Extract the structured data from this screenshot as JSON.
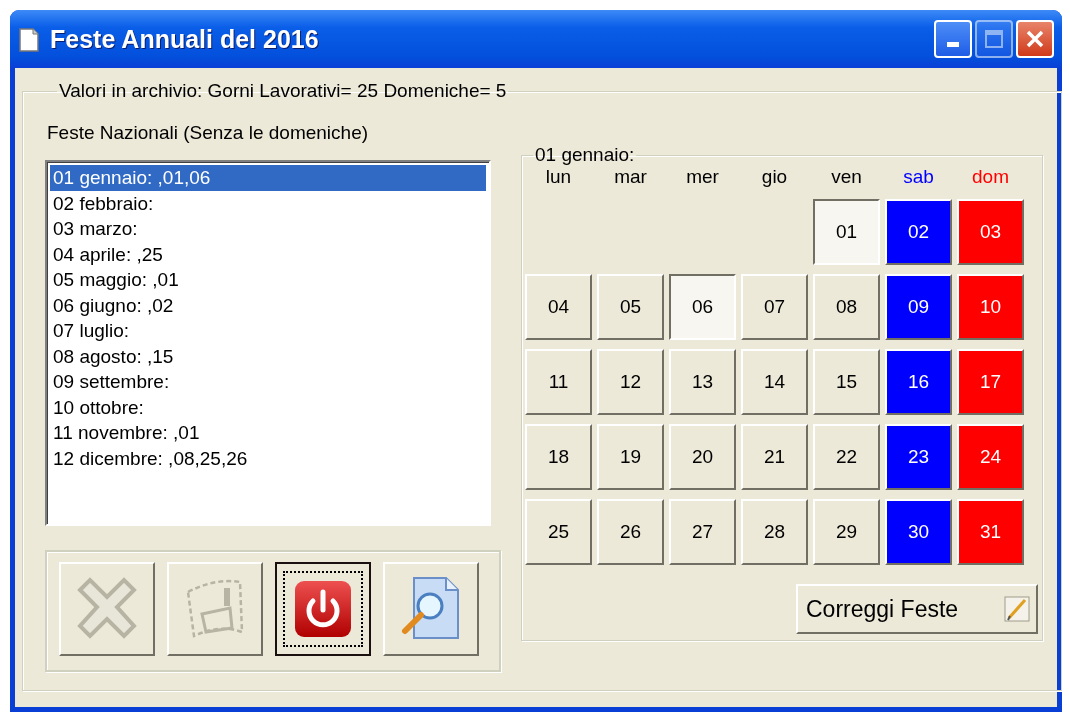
{
  "window": {
    "title": "Feste Annuali del 2016"
  },
  "title_buttons": [
    {
      "kind": "minimize",
      "disabled": false
    },
    {
      "kind": "maximize",
      "disabled": true
    },
    {
      "kind": "close",
      "disabled": false
    }
  ],
  "archive_group": {
    "legend": "Valori in archivio: Gorni Lavorativi= 25 Domeniche= 5"
  },
  "holidays_label": "Feste Nazionali (Senza le domeniche)",
  "holidays_list": [
    {
      "text": "01 gennaio: ,01,06",
      "selected": true
    },
    {
      "text": "02 febbraio:",
      "selected": false
    },
    {
      "text": "03 marzo:",
      "selected": false
    },
    {
      "text": "04 aprile: ,25",
      "selected": false
    },
    {
      "text": "05 maggio: ,01",
      "selected": false
    },
    {
      "text": "06 giugno: ,02",
      "selected": false
    },
    {
      "text": "07 luglio:",
      "selected": false
    },
    {
      "text": "08 agosto: ,15",
      "selected": false
    },
    {
      "text": "09 settembre:",
      "selected": false
    },
    {
      "text": "10 ottobre:",
      "selected": false
    },
    {
      "text": "11 novembre: ,01",
      "selected": false
    },
    {
      "text": "12 dicembre: ,08,25,26",
      "selected": false
    }
  ],
  "toolbar_buttons": [
    {
      "kind": "delete",
      "disabled": true,
      "focused": false
    },
    {
      "kind": "save",
      "disabled": true,
      "focused": false
    },
    {
      "kind": "power",
      "disabled": false,
      "focused": true
    },
    {
      "kind": "preview",
      "disabled": false,
      "focused": false
    }
  ],
  "calendar": {
    "legend": "01 gennaio:",
    "weekdays": [
      {
        "text": "lun",
        "kind": "weekday"
      },
      {
        "text": "mar",
        "kind": "weekday"
      },
      {
        "text": "mer",
        "kind": "weekday"
      },
      {
        "text": "gio",
        "kind": "weekday"
      },
      {
        "text": "ven",
        "kind": "weekday"
      },
      {
        "text": "sab",
        "kind": "saturday"
      },
      {
        "text": "dom",
        "kind": "sunday"
      }
    ],
    "weeks": [
      [
        {
          "text": "01",
          "kind": "weekday",
          "holiday": true
        },
        {
          "text": "02",
          "kind": "saturday",
          "holiday": false
        },
        {
          "text": "03",
          "kind": "sunday",
          "holiday": false
        }
      ],
      [
        {
          "text": "04",
          "kind": "weekday",
          "holiday": false
        },
        {
          "text": "05",
          "kind": "weekday",
          "holiday": false
        },
        {
          "text": "06",
          "kind": "weekday",
          "holiday": true
        },
        {
          "text": "07",
          "kind": "weekday",
          "holiday": false
        },
        {
          "text": "08",
          "kind": "weekday",
          "holiday": false
        },
        {
          "text": "09",
          "kind": "saturday",
          "holiday": false
        },
        {
          "text": "10",
          "kind": "sunday",
          "holiday": false
        }
      ],
      [
        {
          "text": "11",
          "kind": "weekday",
          "holiday": false
        },
        {
          "text": "12",
          "kind": "weekday",
          "holiday": false
        },
        {
          "text": "13",
          "kind": "weekday",
          "holiday": false
        },
        {
          "text": "14",
          "kind": "weekday",
          "holiday": false
        },
        {
          "text": "15",
          "kind": "weekday",
          "holiday": false
        },
        {
          "text": "16",
          "kind": "saturday",
          "holiday": false
        },
        {
          "text": "17",
          "kind": "sunday",
          "holiday": false
        }
      ],
      [
        {
          "text": "18",
          "kind": "weekday",
          "holiday": false
        },
        {
          "text": "19",
          "kind": "weekday",
          "holiday": false
        },
        {
          "text": "20",
          "kind": "weekday",
          "holiday": false
        },
        {
          "text": "21",
          "kind": "weekday",
          "holiday": false
        },
        {
          "text": "22",
          "kind": "weekday",
          "holiday": false
        },
        {
          "text": "23",
          "kind": "saturday",
          "holiday": false
        },
        {
          "text": "24",
          "kind": "sunday",
          "holiday": false
        }
      ],
      [
        {
          "text": "25",
          "kind": "weekday",
          "holiday": false
        },
        {
          "text": "26",
          "kind": "weekday",
          "holiday": false
        },
        {
          "text": "27",
          "kind": "weekday",
          "holiday": false
        },
        {
          "text": "28",
          "kind": "weekday",
          "holiday": false
        },
        {
          "text": "29",
          "kind": "weekday",
          "holiday": false
        },
        {
          "text": "30",
          "kind": "saturday",
          "holiday": false
        },
        {
          "text": "31",
          "kind": "sunday",
          "holiday": false
        }
      ]
    ],
    "edit_button": "Correggi Feste"
  }
}
